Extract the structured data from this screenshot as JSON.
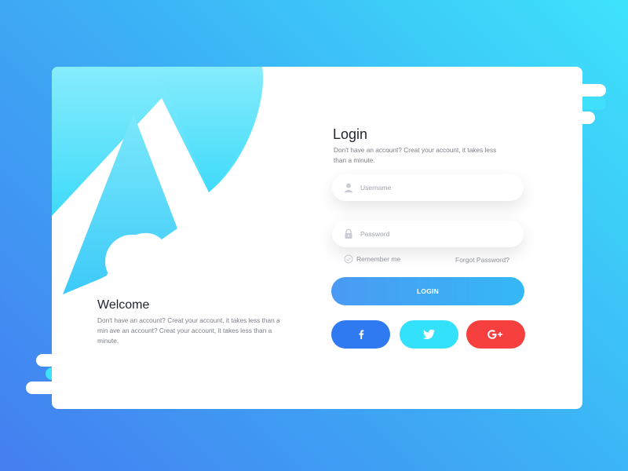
{
  "colors": {
    "background_top": "#3ee3fb",
    "background_bottom": "#447ef0",
    "card": "#ffffff",
    "accent_cyan": "#3fe0fb",
    "login_button_start": "#4a9af4",
    "login_button_end": "#35b8f6",
    "facebook": "#2f79f1",
    "twitter": "#33e1fb",
    "google_plus": "#f5403f"
  },
  "welcome": {
    "title": "Welcome",
    "text": "Don't have an account? Creat your account, it takes less than a min ave an account? Creat your account, it takes less than a minute."
  },
  "login": {
    "title": "Login",
    "subtitle": "Don't have an account? Creat your account, it takes less than a minute.",
    "username": {
      "placeholder": "Username",
      "value": "",
      "icon": "user-icon"
    },
    "password": {
      "placeholder": "Password",
      "value": "",
      "icon": "lock-icon"
    },
    "remember_label": "Remember me",
    "remember_checked": false,
    "forgot_label": "Forgot Password?",
    "button_label": "LOGIN",
    "social": [
      {
        "name": "facebook",
        "icon": "facebook-icon",
        "glyph": "f"
      },
      {
        "name": "twitter",
        "icon": "twitter-icon",
        "glyph": ""
      },
      {
        "name": "google-plus",
        "icon": "google-plus-icon",
        "glyph": "G+"
      }
    ]
  }
}
